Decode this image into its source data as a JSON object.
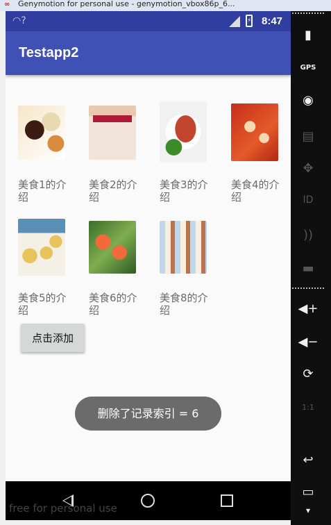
{
  "window": {
    "title": "Genymotion for personal use - genymotion_vbox86p_6..."
  },
  "statusbar": {
    "time": "8:47",
    "wifi_icon": "wifi-icon",
    "signal_icon": "signal-icon",
    "battery_icon": "battery-icon"
  },
  "app": {
    "title": "Testapp2"
  },
  "grid": {
    "items": [
      {
        "caption": "美食1的介绍",
        "image": "food-1"
      },
      {
        "caption": "美食2的介绍",
        "image": "food-2"
      },
      {
        "caption": "美食3的介绍",
        "image": "food-3"
      },
      {
        "caption": "美食4的介绍",
        "image": "food-4"
      },
      {
        "caption": "美食5的介绍",
        "image": "food-5"
      },
      {
        "caption": "美食6的介绍",
        "image": "food-6"
      },
      {
        "caption": "美食8的介绍",
        "image": "food-8"
      }
    ]
  },
  "add_button": {
    "label": "点击添加"
  },
  "toast": {
    "text": "删除了记录索引 = 6"
  },
  "navbar": {
    "back_icon": "back-icon",
    "home_icon": "home-icon",
    "recent_icon": "recent-apps-icon"
  },
  "footer": {
    "watermark": "free for personal use"
  },
  "sidebar": {
    "items": [
      {
        "icon": "battery-icon",
        "glyph": "▮"
      },
      {
        "icon": "gps-icon",
        "glyph": "GPS"
      },
      {
        "icon": "webcam-icon",
        "glyph": "◉"
      },
      {
        "icon": "clapper-icon",
        "glyph": "▤"
      },
      {
        "icon": "dpad-icon",
        "glyph": "✥"
      },
      {
        "icon": "id-icon",
        "glyph": "ID"
      },
      {
        "icon": "rss-icon",
        "glyph": "))"
      },
      {
        "icon": "sms-icon",
        "glyph": "▬"
      },
      {
        "icon": "volume-up-icon",
        "glyph": "◀+"
      },
      {
        "icon": "volume-down-icon",
        "glyph": "◀−"
      },
      {
        "icon": "rotate-icon",
        "glyph": "⟳"
      },
      {
        "icon": "pixel-perfect-icon",
        "glyph": "1:1"
      },
      {
        "icon": "back-icon",
        "glyph": "↩"
      },
      {
        "icon": "menu-icon",
        "glyph": "▭"
      },
      {
        "icon": "home-icon",
        "glyph": "▾"
      }
    ]
  }
}
